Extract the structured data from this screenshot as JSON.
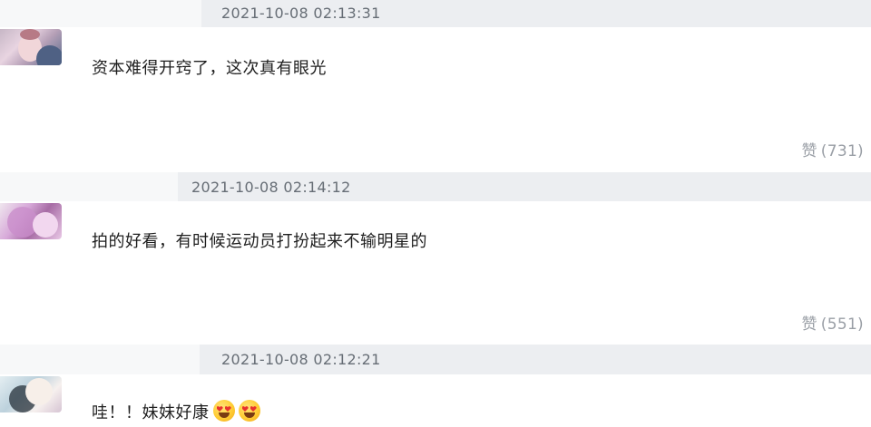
{
  "comments": [
    {
      "timestamp": "2021-10-08 02:13:31",
      "text": "资本难得开窍了，这次真有眼光",
      "like_label": "赞",
      "like_count": "(731)",
      "avatar_icon": "user-avatar"
    },
    {
      "timestamp": "2021-10-08 02:14:12",
      "text": "拍的好看，有时候运动员打扮起来不输明星的",
      "like_label": "赞",
      "like_count": "(551)",
      "avatar_icon": "user-avatar"
    },
    {
      "timestamp": "2021-10-08 02:12:21",
      "text": "哇！！妹妹好康",
      "emoji": [
        "heart-eyes-emoji",
        "heart-eyes-emoji"
      ],
      "avatar_icon": "user-avatar"
    }
  ]
}
